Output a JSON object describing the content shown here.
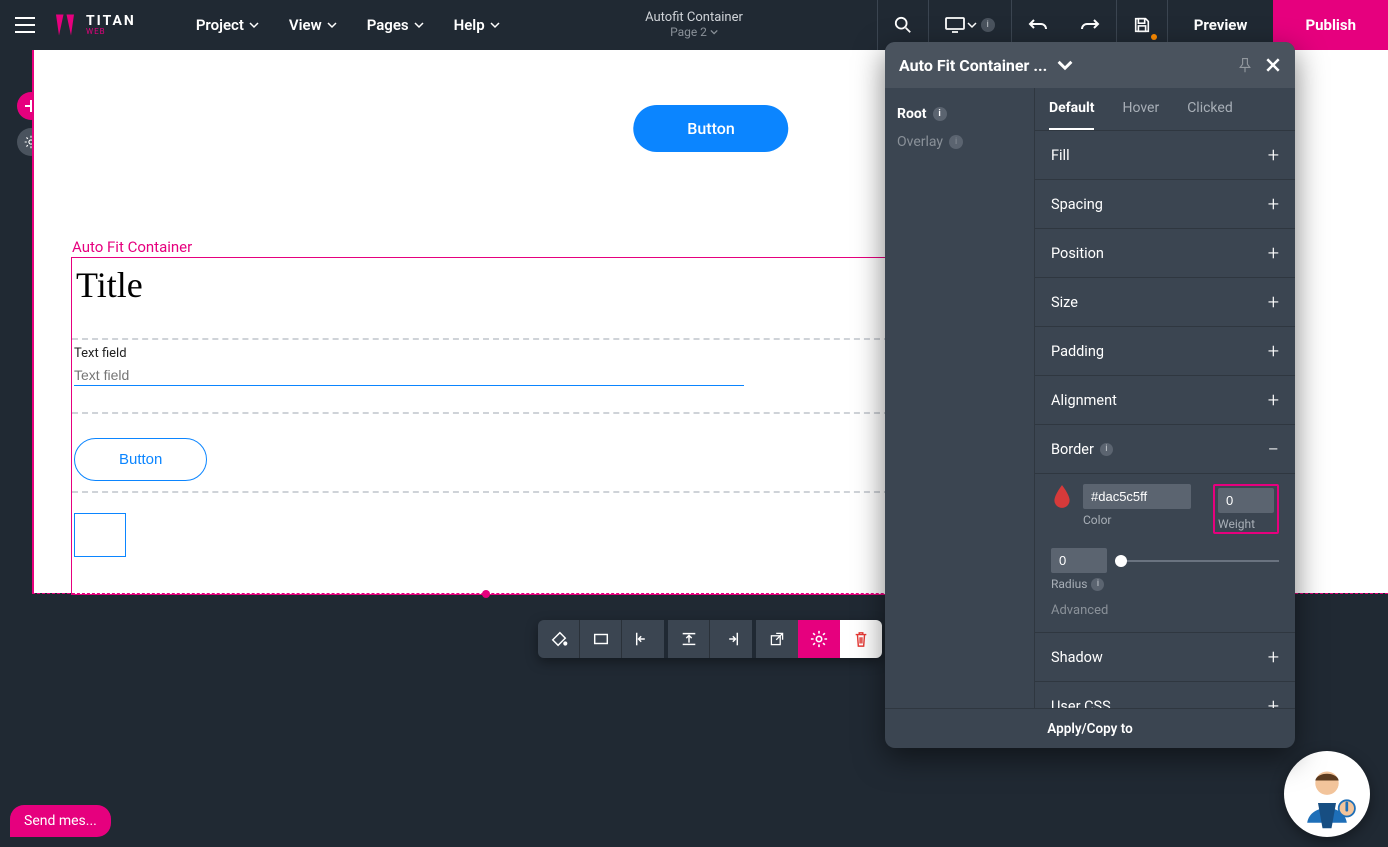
{
  "brand": {
    "title": "TITAN",
    "sub": "WEB"
  },
  "menu": [
    "Project",
    "View",
    "Pages",
    "Help"
  ],
  "center": {
    "title": "Autofit Container",
    "page": "Page 2"
  },
  "device_badge": "i",
  "actions": {
    "preview": "Preview",
    "publish": "Publish"
  },
  "canvas": {
    "button_label": "Button",
    "afc_label": "Auto Fit Container",
    "title_text": "Title",
    "textfield_label": "Text field",
    "textfield_placeholder": "Text field",
    "outline_button": "Button"
  },
  "panel": {
    "title": "Auto Fit Container ...",
    "tree": {
      "root": "Root",
      "overlay": "Overlay"
    },
    "tabs": {
      "default": "Default",
      "hover": "Hover",
      "clicked": "Clicked"
    },
    "sections": {
      "fill": "Fill",
      "spacing": "Spacing",
      "position": "Position",
      "size": "Size",
      "padding": "Padding",
      "alignment": "Alignment",
      "border": "Border",
      "shadow": "Shadow",
      "usercss": "User CSS"
    },
    "border": {
      "color_value": "#dac5c5ff",
      "color_label": "Color",
      "weight_value": "0",
      "weight_label": "Weight",
      "radius_value": "0",
      "radius_label": "Radius",
      "advanced": "Advanced"
    },
    "footer": "Apply/Copy to"
  },
  "chat": "Send mes..."
}
